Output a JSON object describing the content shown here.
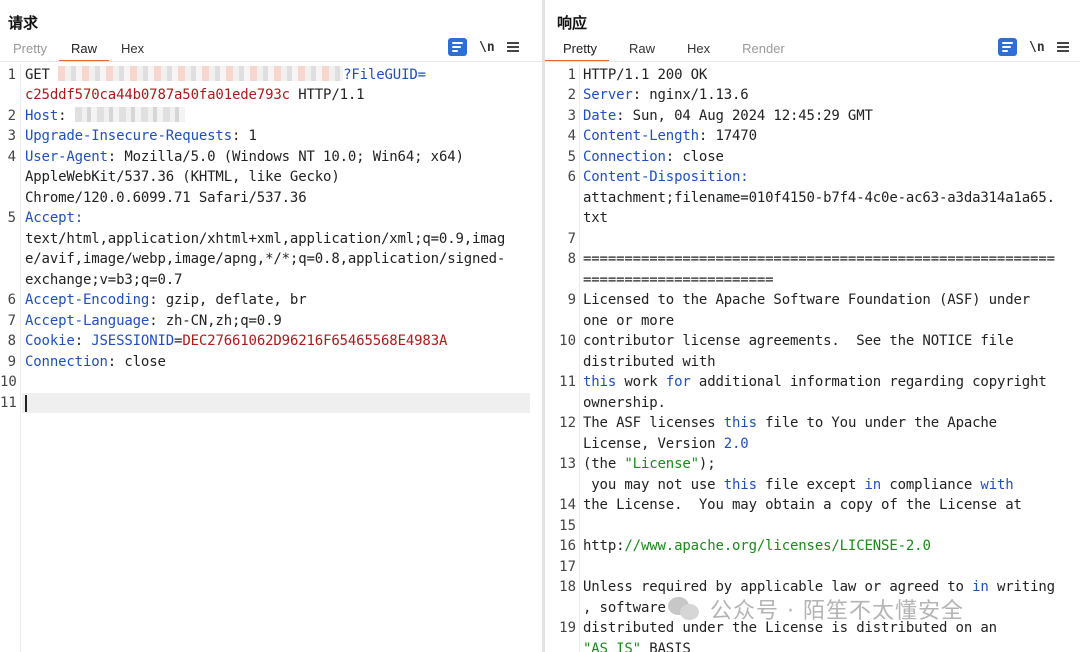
{
  "request": {
    "title": "请求",
    "tabs": [
      "Pretty",
      "Raw",
      "Hex"
    ],
    "lines": [
      {
        "n": "1"
      },
      {
        "n": "2"
      },
      {
        "n": "3"
      },
      {
        "n": "4"
      },
      {
        "n": "5"
      },
      {
        "n": "6"
      },
      {
        "n": "7"
      },
      {
        "n": "8"
      },
      {
        "n": "9"
      },
      {
        "n": "10"
      },
      {
        "n": "11"
      }
    ],
    "l1a": "GET ",
    "l1b": "?FileGUID=",
    "l1c": "c25ddf570ca44b0787a50fa01ede793c",
    "l1d": " HTTP/1.1",
    "host_k": "Host",
    "host_sep": ": ",
    "uir_k": "Upgrade-Insecure-Requests",
    "uir_v": ": 1",
    "ua_k": "User-Agent",
    "ua_v1": ": Mozilla/5.0 (Windows NT 10.0; Win64; x64)",
    "ua_v2": "AppleWebKit/537.36 (KHTML, like Gecko)",
    "ua_v3": "Chrome/120.0.6099.71 Safari/537.36",
    "acc_k": "Accept",
    "acc_sep": ":",
    "acc_v1": "text/html,application/xhtml+xml,application/xml;q=0.9,imag",
    "acc_v2": "e/avif,image/webp,image/apng,*/*;q=0.8,application/signed-",
    "acc_v3": "exchange;v=b3;q=0.7",
    "ae_k": "Accept-Encoding",
    "ae_v": ": gzip, deflate, br",
    "al_k": "Accept-Language",
    "al_v": ": zh-CN,zh;q=0.9",
    "ck_k": "Cookie",
    "ck_sep": ": ",
    "ck_name": "JSESSIONID",
    "ck_eq": "=",
    "ck_val": "DEC27661062D96216F65465568E4983A",
    "conn_k": "Connection",
    "conn_v": ": close"
  },
  "response": {
    "title": "响应",
    "tabs": [
      "Pretty",
      "Raw",
      "Hex",
      "Render"
    ],
    "lines": [
      {
        "n": "1"
      },
      {
        "n": "2"
      },
      {
        "n": "3"
      },
      {
        "n": "4"
      },
      {
        "n": "5"
      },
      {
        "n": "6"
      },
      {
        "n": "7"
      },
      {
        "n": "8"
      },
      {
        "n": "9"
      },
      {
        "n": "10"
      },
      {
        "n": "11"
      },
      {
        "n": "12"
      },
      {
        "n": "13"
      },
      {
        "n": "14"
      },
      {
        "n": "15"
      },
      {
        "n": "16"
      },
      {
        "n": "17"
      },
      {
        "n": "18"
      },
      {
        "n": "19"
      }
    ],
    "status": "HTTP/1.1 200 OK",
    "server_k": "Server",
    "server_v": ": nginx/1.13.6",
    "date_k": "Date",
    "date_v": ": Sun, 04 Aug 2024 12:45:29 GMT",
    "cl_k": "Content-Length",
    "cl_v": ": 17470",
    "conn_k": "Connection",
    "conn_v": ": close",
    "cd_k": "Content-Disposition",
    "cd_sep": ":",
    "cd_v1": "attachment;filename=010f4150-b7f4-4c0e-ac63-a3da314a1a65.",
    "cd_v2": "txt",
    "eq1": "=========================================================",
    "eq2": "=======================",
    "b9a": "Licensed to the Apache Software Foundation (ASF) under",
    "b9b": "one or more",
    "b10a": "contributor license agreements.  See the NOTICE file",
    "b10b": "distributed with",
    "b11_kw": "this",
    "b11_a": " work ",
    "b11_kw2": "for",
    "b11_b": " additional information regarding copyright",
    "b11c": "ownership.",
    "b12_a": "The ASF licenses ",
    "b12_kw": "this",
    "b12_b": " file to You under the Apache",
    "b12c_a": "License, Version ",
    "b12c_num": "2.0",
    "b13_a": "(the ",
    "b13_str": "\"License\"",
    "b13_b": ");",
    "b13c_a": " you may not use ",
    "b13c_kw": "this",
    "b13c_b": " file except ",
    "b13c_kw2": "in",
    "b13c_c": " compliance ",
    "b13c_kw3": "with",
    "b14": "the License.  You may obtain a copy of the License at",
    "b16_a": "http:",
    "b16_b": "//www.apache.org/licenses/LICENSE-2.0",
    "b18_a": "Unless required by applicable law or agreed to ",
    "b18_kw": "in",
    "b18_b": " writing",
    "b18c": ", software",
    "b19": "distributed under the License is distributed on an",
    "b19c_str": "\"AS IS\"",
    "b19c_b": " BASIS"
  },
  "toolbar": {
    "newline_label": "\\n"
  },
  "watermark": {
    "text": "公众号 · 陌笙不太懂安全"
  }
}
